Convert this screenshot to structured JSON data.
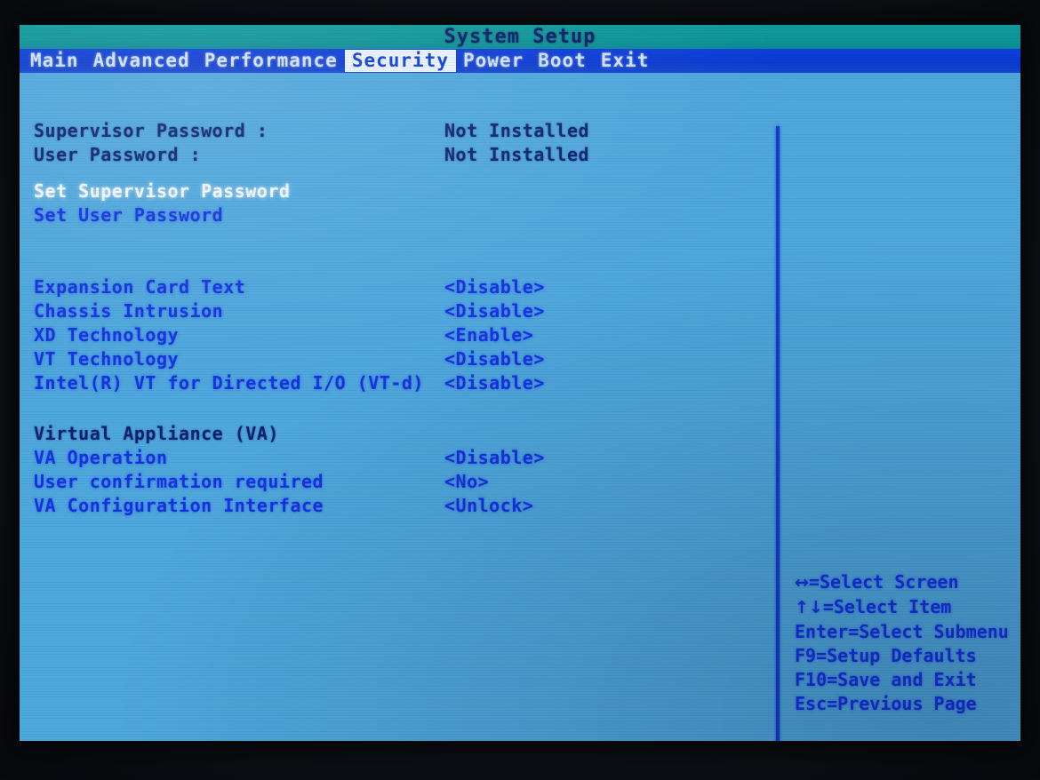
{
  "screen": {
    "title": "System Setup",
    "background_color": "#4ea7dd",
    "title_bar_color": "#0d9398",
    "menu_bar_color": "#0c3ad2",
    "label_color": "#0d2272",
    "value_color": "#1533e0",
    "highlight_color": "#f2f8ff"
  },
  "menu": {
    "items": [
      {
        "label": "Main",
        "active": false
      },
      {
        "label": "Advanced",
        "active": false
      },
      {
        "label": "Performance",
        "active": false
      },
      {
        "label": "Security",
        "active": true
      },
      {
        "label": "Power",
        "active": false
      },
      {
        "label": "Boot",
        "active": false
      },
      {
        "label": "Exit",
        "active": false
      }
    ]
  },
  "settings": {
    "status_rows": [
      {
        "label": "Supervisor Password :",
        "value": "Not Installed"
      },
      {
        "label": "User Password :",
        "value": "Not Installed"
      }
    ],
    "password_actions": [
      {
        "label": "Set Supervisor Password",
        "selected": true
      },
      {
        "label": "Set User Password",
        "selected": false
      }
    ],
    "feature_rows": [
      {
        "label": "Expansion Card Text",
        "value": "<Disable>"
      },
      {
        "label": "Chassis Intrusion",
        "value": "<Disable>"
      },
      {
        "label": "XD Technology",
        "value": "<Enable>"
      },
      {
        "label": "VT Technology",
        "value": "<Disable>"
      },
      {
        "label": "Intel(R) VT for Directed I/O (VT-d)",
        "value": "<Disable>"
      }
    ],
    "va_section": {
      "heading": "Virtual Appliance (VA)",
      "rows": [
        {
          "label": "VA Operation",
          "value": "<Disable>"
        },
        {
          "label": "User confirmation required",
          "value": "<No>"
        },
        {
          "label": "VA Configuration Interface",
          "value": "<Unlock>"
        }
      ]
    }
  },
  "help": {
    "lines": [
      {
        "key": "↔",
        "text": "=Select Screen"
      },
      {
        "key": "↑↓",
        "text": "=Select Item"
      },
      {
        "key": "Enter",
        "text": "=Select Submenu"
      },
      {
        "key": "F9",
        "text": "=Setup Defaults"
      },
      {
        "key": "F10",
        "text": "=Save and Exit"
      },
      {
        "key": "Esc",
        "text": "=Previous Page"
      }
    ]
  }
}
